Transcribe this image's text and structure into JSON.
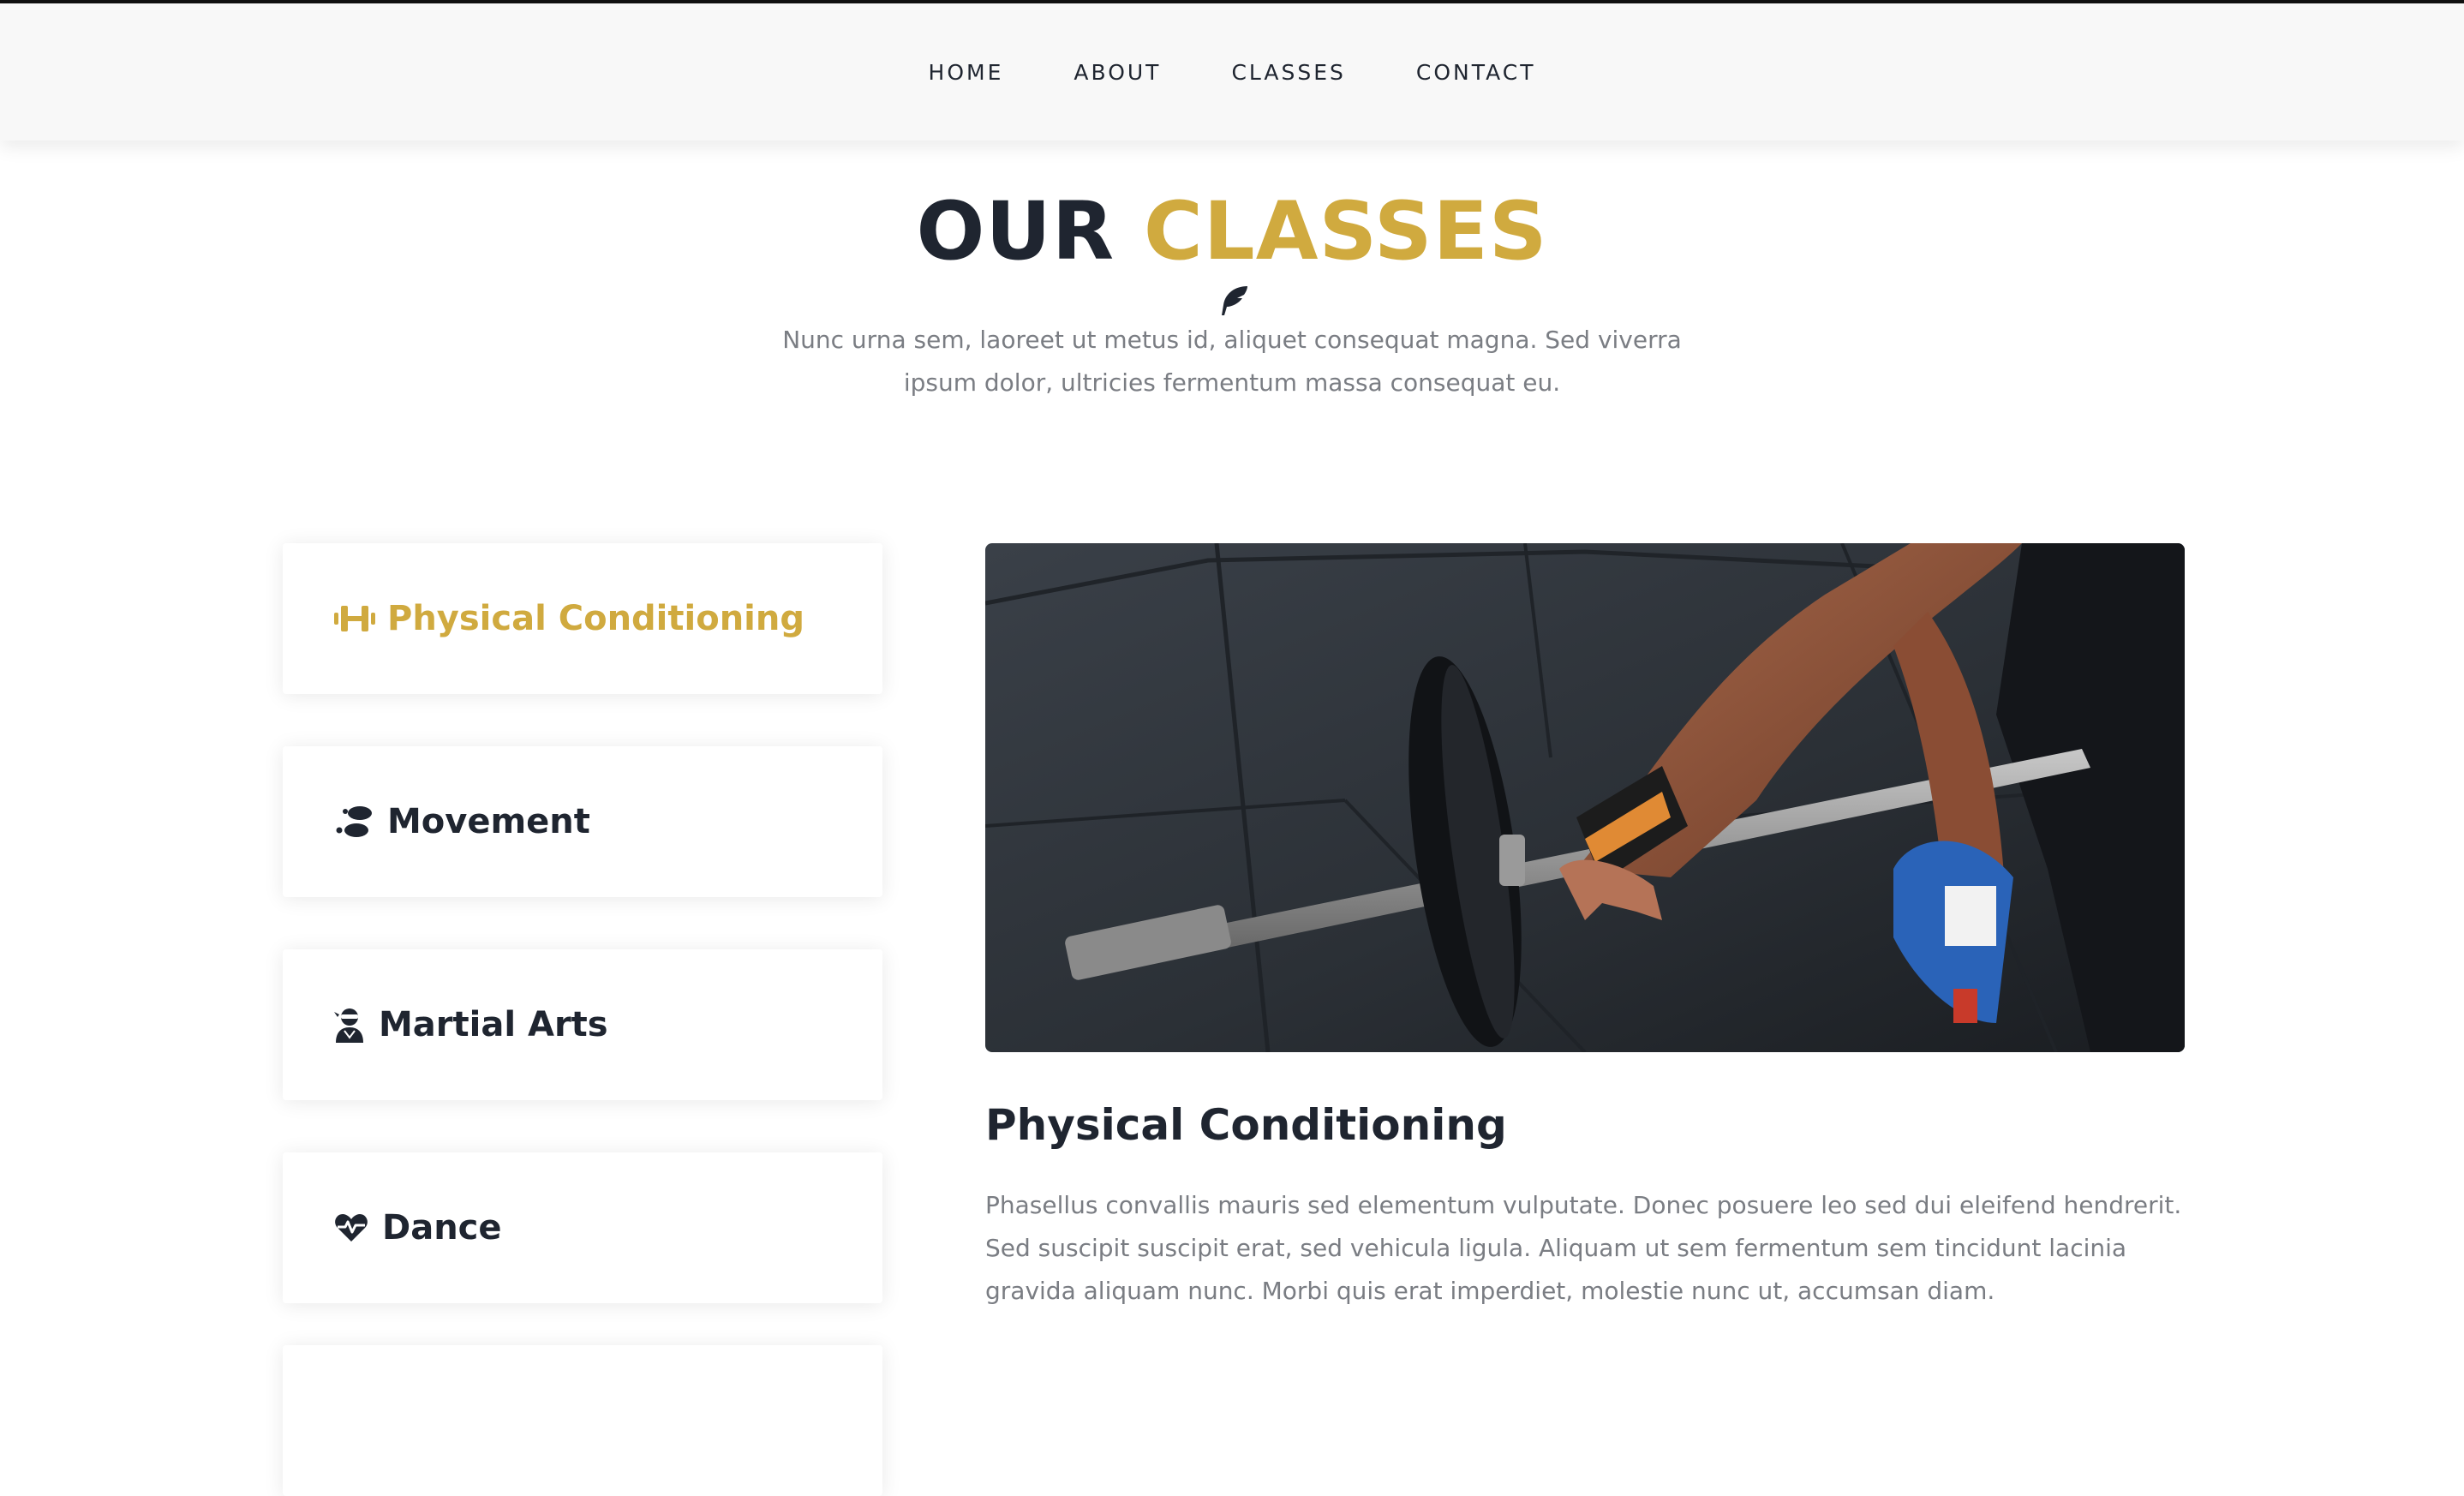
{
  "nav": {
    "items": [
      "HOME",
      "ABOUT",
      "CLASSES",
      "CONTACT"
    ]
  },
  "section": {
    "title_dark": "OUR",
    "title_accent": "CLASSES",
    "intro": "Nunc urna sem, laoreet ut metus id, aliquet consequat magna. Sed viverra ipsum dolor, ultricies fermentum massa consequat eu."
  },
  "classes": [
    {
      "label": "Physical Conditioning",
      "icon": "dumbbell-icon",
      "active": true
    },
    {
      "label": "Movement",
      "icon": "footprints-icon",
      "active": false
    },
    {
      "label": "Martial Arts",
      "icon": "user-ninja-icon",
      "active": false
    },
    {
      "label": "Dance",
      "icon": "heartbeat-icon",
      "active": false
    }
  ],
  "detail": {
    "title": "Physical Conditioning",
    "text": "Phasellus convallis mauris sed elementum vulputate. Donec posuere leo sed dui eleifend hendrerit. Sed suscipit suscipit erat, sed vehicula ligula. Aliquam ut sem fermentum sem tincidunt lacinia gravida aliquam nunc. Morbi quis erat imperdiet, molestie nunc ut, accumsan diam."
  },
  "colors": {
    "accent": "#d0aa3f",
    "dark": "#1f2530",
    "muted": "#7a7d83"
  }
}
